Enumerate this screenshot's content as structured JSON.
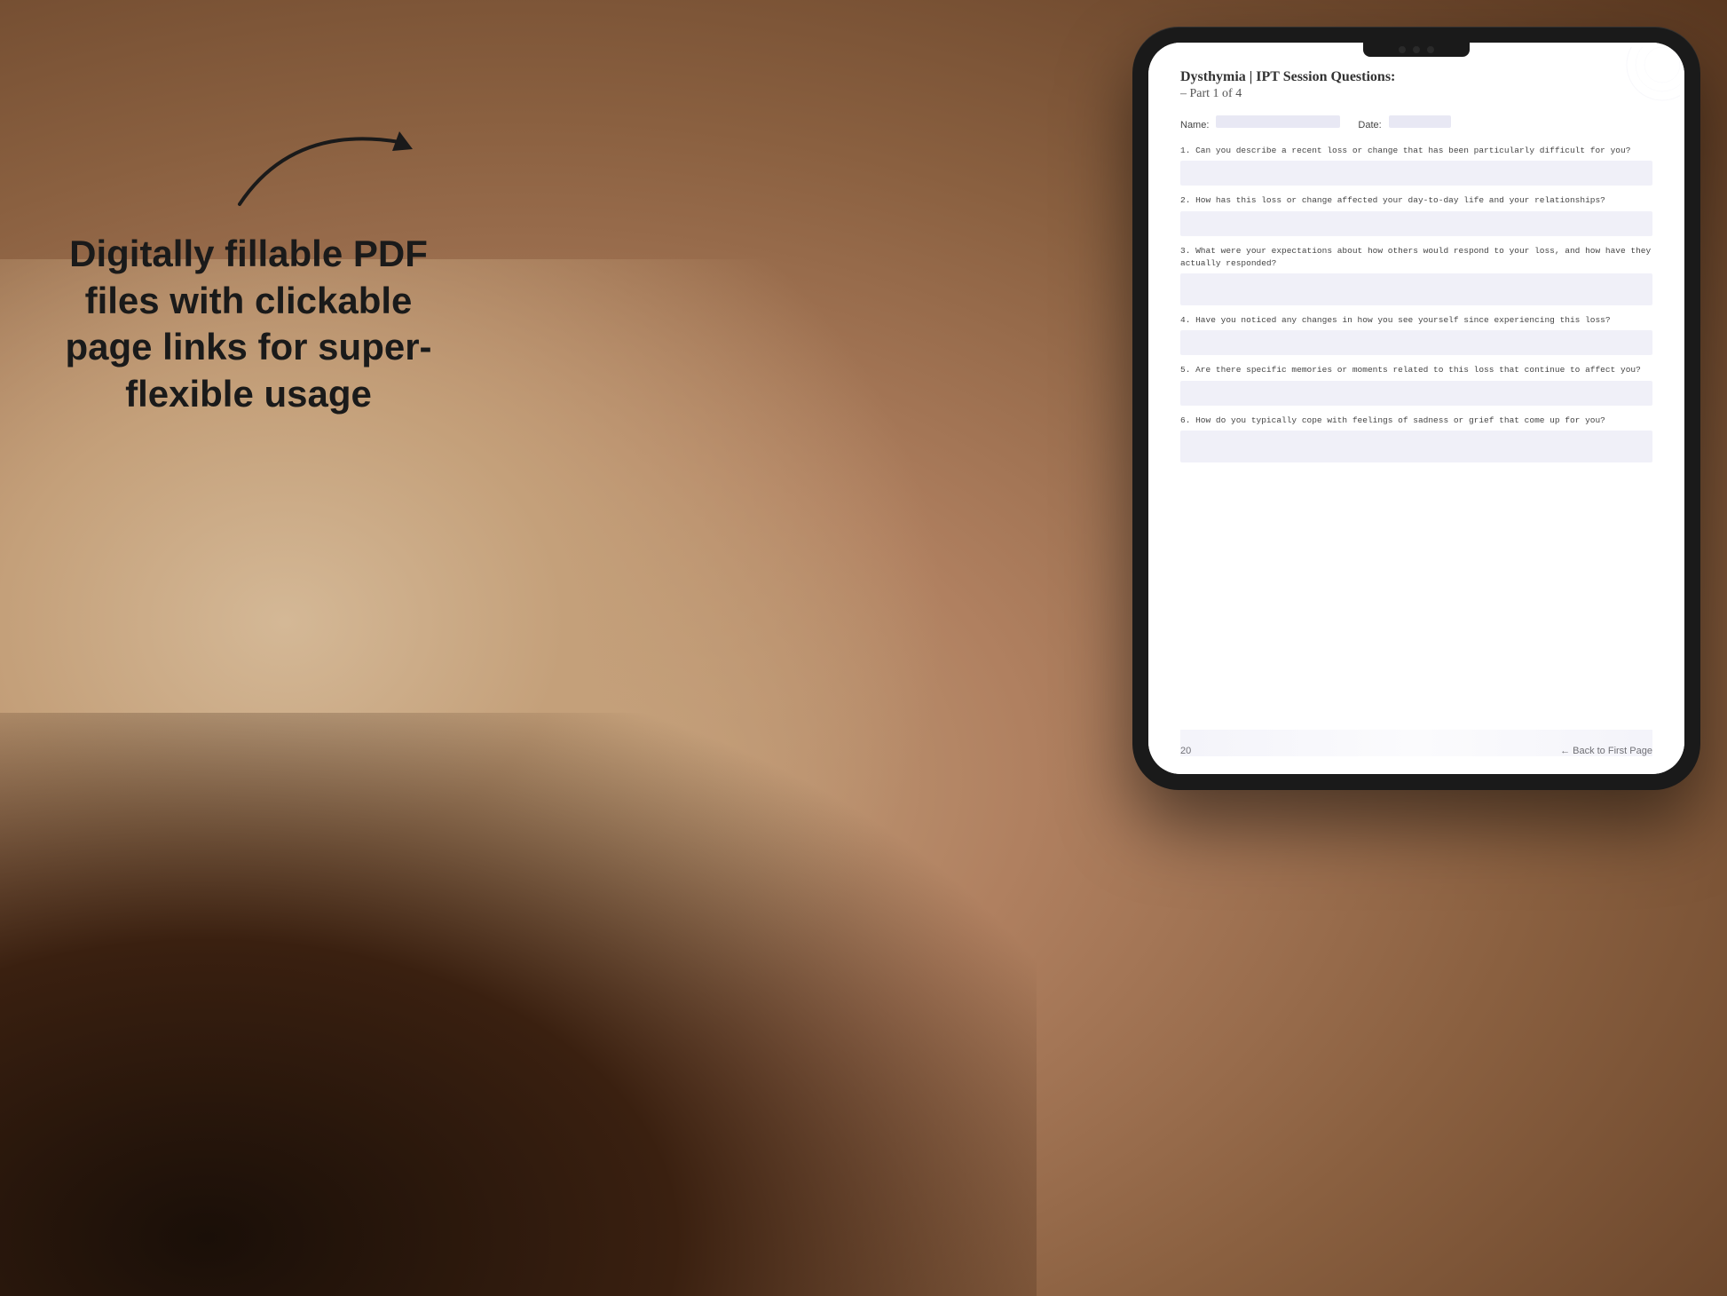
{
  "background": {
    "color_main": "#b8967a",
    "color_dark": "#3a2010"
  },
  "left_text": {
    "heading": "Digitally fillable PDF files with clickable page links for super-flexible usage"
  },
  "tablet": {
    "screen_color": "#ffffff"
  },
  "pdf": {
    "title": "Dysthymia | IPT Session Questions:",
    "subtitle": "– Part 1 of 4",
    "name_label": "Name:",
    "date_label": "Date:",
    "questions": [
      {
        "number": "1.",
        "text": "Can you describe a recent loss or change that has been particularly difficult for you?"
      },
      {
        "number": "2.",
        "text": "How has this loss or change affected your day-to-day life and your relationships?"
      },
      {
        "number": "3.",
        "text": "What were your expectations about how others would respond to your loss, and how have they actually responded?"
      },
      {
        "number": "4.",
        "text": "Have you noticed any changes in how you see yourself since experiencing this loss?"
      },
      {
        "number": "5.",
        "text": "Are there specific memories or moments related to this loss that continue to affect you?"
      },
      {
        "number": "6.",
        "text": "How do you typically cope with feelings of sadness or grief that come up for you?"
      }
    ],
    "footer": {
      "page_number": "20",
      "back_link": "← Back to First Page"
    }
  }
}
